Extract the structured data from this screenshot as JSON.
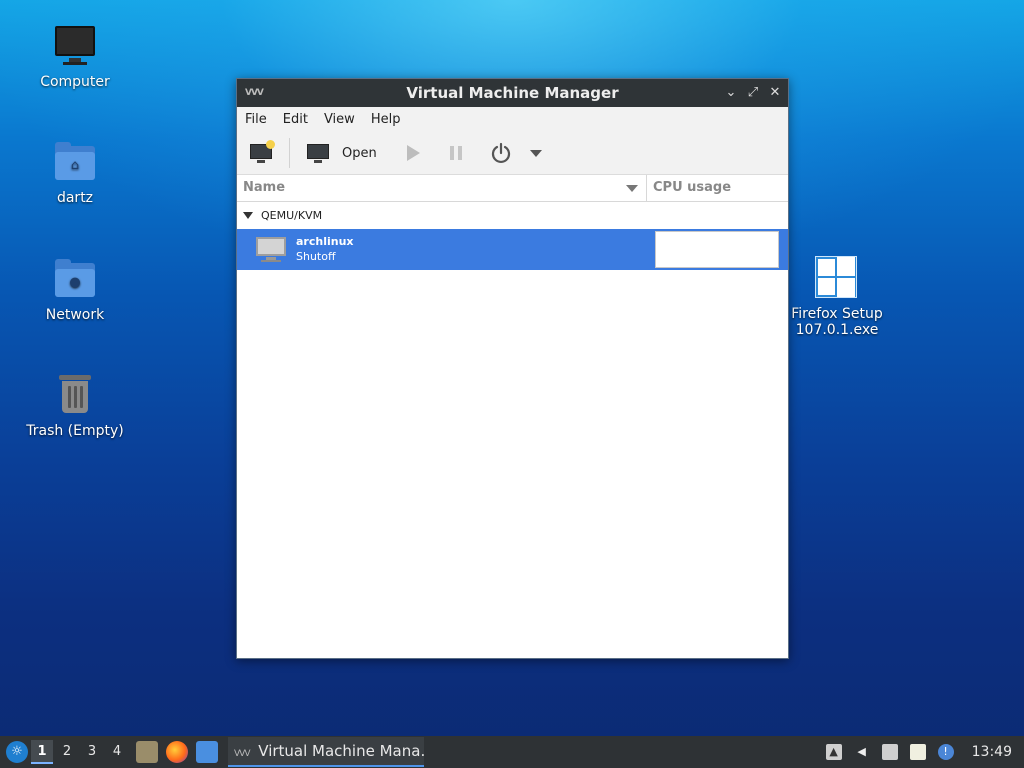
{
  "desktop": {
    "icons": [
      {
        "label": "Computer"
      },
      {
        "label": "dartz"
      },
      {
        "label": "Network"
      },
      {
        "label": "Trash (Empty)"
      },
      {
        "label": "Firefox Setup 107.0.1.exe"
      }
    ]
  },
  "window": {
    "title": "Virtual Machine Manager",
    "logo_text": "VVV",
    "controls": {
      "minimize": "⌄",
      "maximize": "⤢",
      "close": "✕"
    },
    "menu": [
      "File",
      "Edit",
      "View",
      "Help"
    ],
    "toolbar": {
      "open_label": "Open"
    },
    "columns": {
      "name": "Name",
      "cpu": "CPU usage"
    },
    "group": "QEMU/KVM",
    "vms": [
      {
        "name": "archlinux",
        "status": "Shutoff"
      }
    ]
  },
  "taskbar": {
    "workspaces": [
      "1",
      "2",
      "3",
      "4"
    ],
    "active_workspace": "1",
    "task_label": "Virtual Machine Mana...",
    "clock": "13:49"
  },
  "colors": {
    "selection": "#3b7be0",
    "titlebar": "#2f3437",
    "taskbar": "#2e3235"
  }
}
